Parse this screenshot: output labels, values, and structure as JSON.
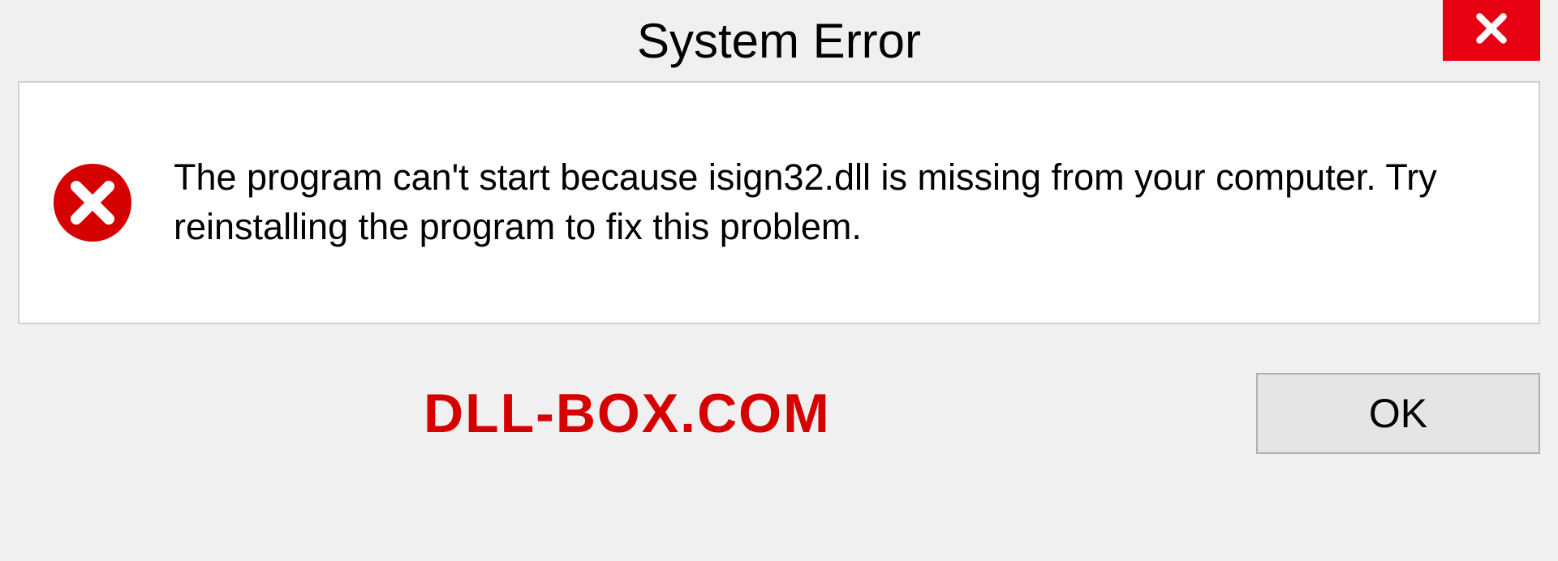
{
  "dialog": {
    "title": "System Error",
    "message": "The program can't start because isign32.dll is missing from your computer. Try reinstalling the program to fix this problem.",
    "ok_label": "OK"
  },
  "watermark": "DLL-BOX.COM",
  "colors": {
    "close_bg": "#e60012",
    "error_icon": "#d50000",
    "watermark": "#d50000"
  }
}
